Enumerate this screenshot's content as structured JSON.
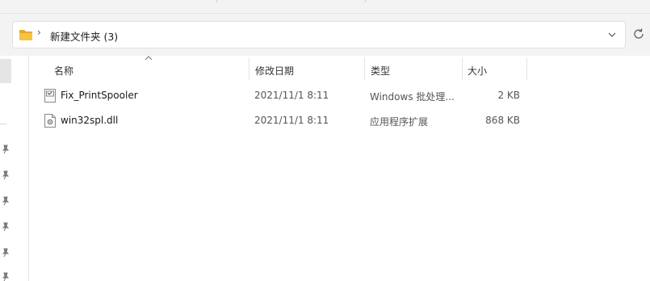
{
  "address": {
    "crumb_separator": "›",
    "path": "新建文件夹 (3)"
  },
  "columns": {
    "name": "名称",
    "date": "修改日期",
    "type": "类型",
    "size": "大小"
  },
  "files": [
    {
      "name": "Fix_PrintSpooler",
      "date": "2021/11/1 8:11",
      "type": "Windows 批处理...",
      "size": "2 KB",
      "icon": "batch-file-icon"
    },
    {
      "name": "win32spl.dll",
      "date": "2021/11/1 8:11",
      "type": "应用程序扩展",
      "size": "868 KB",
      "icon": "dll-file-icon"
    }
  ],
  "colors": {
    "folder": "#f6c343",
    "toolbar_bg": "#f3f3f3",
    "pin": "#7a7a7a"
  }
}
